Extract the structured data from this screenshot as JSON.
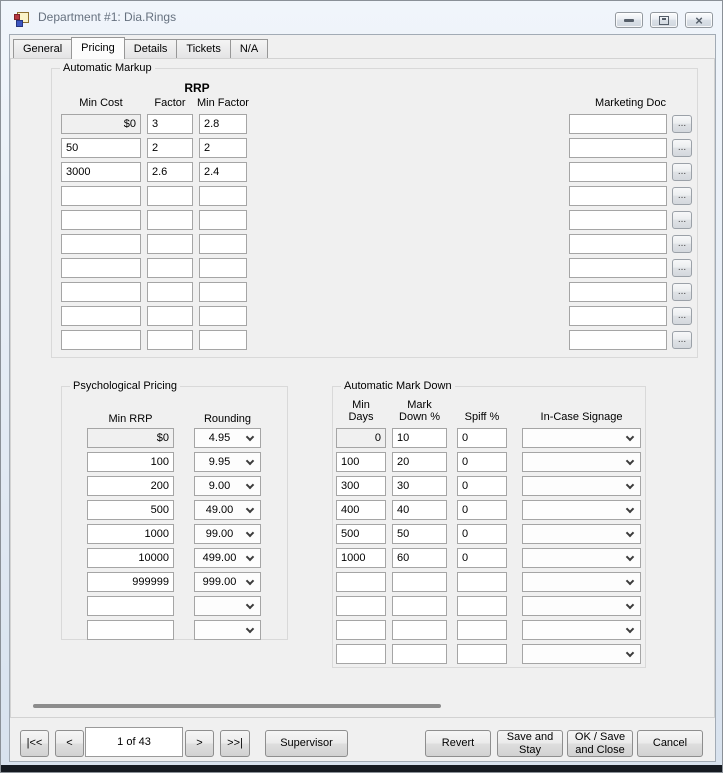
{
  "window": {
    "title": "Department #1: Dia.Rings",
    "close_glyph": "×"
  },
  "tabs": [
    {
      "label": "General"
    },
    {
      "label": "Pricing"
    },
    {
      "label": "Details"
    },
    {
      "label": "Tickets"
    },
    {
      "label": "N/A"
    }
  ],
  "automatic_markup": {
    "title": "Automatic Markup",
    "rrp_header": "RRP",
    "col_min_cost": "Min Cost",
    "col_factor": "Factor",
    "col_min_factor": "Min Factor",
    "col_marketing_doc": "Marketing Doc",
    "browse_label": "...",
    "rows": [
      {
        "min_cost": "$0",
        "factor": "3",
        "min_factor": "2.8",
        "marketing_doc": ""
      },
      {
        "min_cost": "50",
        "factor": "2",
        "min_factor": "2",
        "marketing_doc": ""
      },
      {
        "min_cost": "3000",
        "factor": "2.6",
        "min_factor": "2.4",
        "marketing_doc": ""
      },
      {
        "min_cost": "",
        "factor": "",
        "min_factor": "",
        "marketing_doc": ""
      },
      {
        "min_cost": "",
        "factor": "",
        "min_factor": "",
        "marketing_doc": ""
      },
      {
        "min_cost": "",
        "factor": "",
        "min_factor": "",
        "marketing_doc": ""
      },
      {
        "min_cost": "",
        "factor": "",
        "min_factor": "",
        "marketing_doc": ""
      },
      {
        "min_cost": "",
        "factor": "",
        "min_factor": "",
        "marketing_doc": ""
      },
      {
        "min_cost": "",
        "factor": "",
        "min_factor": "",
        "marketing_doc": ""
      },
      {
        "min_cost": "",
        "factor": "",
        "min_factor": "",
        "marketing_doc": ""
      }
    ]
  },
  "psychological_pricing": {
    "title": "Psychological Pricing",
    "col_min_rrp": "Min RRP",
    "col_rounding": "Rounding",
    "rows": [
      {
        "min_rrp": "$0",
        "rounding": "4.95"
      },
      {
        "min_rrp": "100",
        "rounding": "9.95"
      },
      {
        "min_rrp": "200",
        "rounding": "9.00"
      },
      {
        "min_rrp": "500",
        "rounding": "49.00"
      },
      {
        "min_rrp": "1000",
        "rounding": "99.00"
      },
      {
        "min_rrp": "10000",
        "rounding": "499.00"
      },
      {
        "min_rrp": "999999",
        "rounding": "999.00"
      },
      {
        "min_rrp": "",
        "rounding": ""
      },
      {
        "min_rrp": "",
        "rounding": ""
      }
    ]
  },
  "automatic_mark_down": {
    "title": "Automatic Mark Down",
    "col_min_days": "Min Days",
    "col_mark_down": "Mark Down %",
    "col_spiff": "Spiff %",
    "col_signage": "In-Case Signage",
    "rows": [
      {
        "min_days": "0",
        "mark_down": "10",
        "spiff": "0",
        "signage": ""
      },
      {
        "min_days": "100",
        "mark_down": "20",
        "spiff": "0",
        "signage": ""
      },
      {
        "min_days": "300",
        "mark_down": "30",
        "spiff": "0",
        "signage": ""
      },
      {
        "min_days": "400",
        "mark_down": "40",
        "spiff": "0",
        "signage": ""
      },
      {
        "min_days": "500",
        "mark_down": "50",
        "spiff": "0",
        "signage": ""
      },
      {
        "min_days": "1000",
        "mark_down": "60",
        "spiff": "0",
        "signage": ""
      },
      {
        "min_days": "",
        "mark_down": "",
        "spiff": "",
        "signage": ""
      },
      {
        "min_days": "",
        "mark_down": "",
        "spiff": "",
        "signage": ""
      },
      {
        "min_days": "",
        "mark_down": "",
        "spiff": "",
        "signage": ""
      },
      {
        "min_days": "",
        "mark_down": "",
        "spiff": "",
        "signage": ""
      }
    ]
  },
  "navigation": {
    "first": "|<<",
    "previous": "<",
    "position": "1 of 43",
    "next": ">",
    "last": ">>|",
    "supervisor": "Supervisor"
  },
  "actions": {
    "revert": "Revert",
    "save_and_stay": "Save and Stay",
    "ok_save_close": "OK / Save and Close",
    "cancel": "Cancel"
  },
  "colors": {
    "titlebar_top": "#f0f5fb",
    "titlebar_bottom": "#d8e2ee",
    "disabled_field": "#f0f0f0",
    "scrollbar_thumb": "#8c8c8c",
    "bottom_edge": "#151a21"
  }
}
